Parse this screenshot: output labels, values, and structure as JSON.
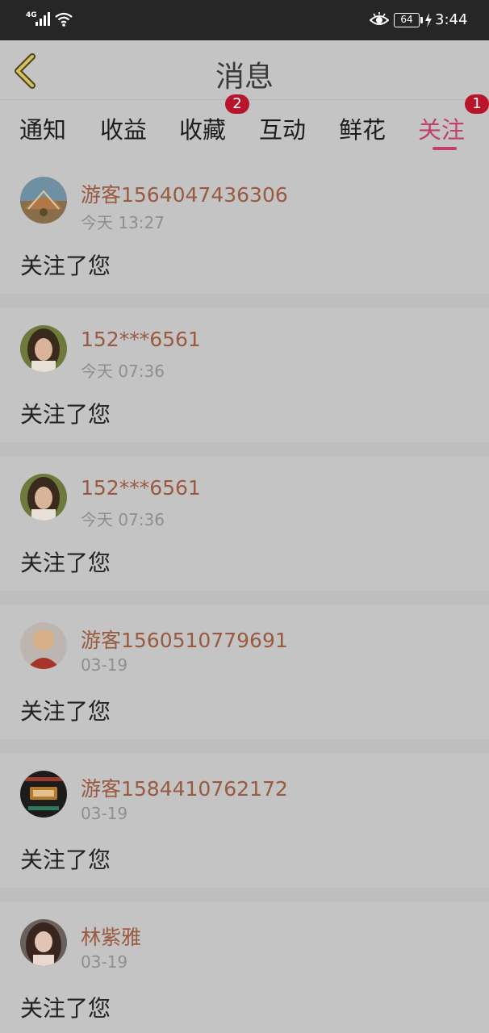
{
  "status_bar": {
    "network": "4G",
    "battery": "64",
    "time": "3:44"
  },
  "header": {
    "title": "消息"
  },
  "tabs": [
    {
      "label": "通知",
      "badge": null
    },
    {
      "label": "收益",
      "badge": null
    },
    {
      "label": "收藏",
      "badge": "2"
    },
    {
      "label": "互动",
      "badge": null
    },
    {
      "label": "鲜花",
      "badge": null
    },
    {
      "label": "关注",
      "badge": "1",
      "active": true
    }
  ],
  "colors": {
    "accent": "#c0406e",
    "username": "#9a5a3f",
    "badge": "#b8142c"
  },
  "feed": [
    {
      "username": "游客1564047436306",
      "time": "今天 13:27",
      "message": "关注了您",
      "avatar": "beach-sunset-avatar"
    },
    {
      "username": "152***6561",
      "time": "今天 07:36",
      "message": "关注了您",
      "avatar": "woman-portrait-avatar"
    },
    {
      "username": "152***6561",
      "time": "今天 07:36",
      "message": "关注了您",
      "avatar": "woman-portrait-avatar"
    },
    {
      "username": "游客1560510779691",
      "time": "03-19",
      "message": "关注了您",
      "avatar": "red-shirt-person-avatar"
    },
    {
      "username": "游客1584410762172",
      "time": "03-19",
      "message": "关注了您",
      "avatar": "dark-logo-avatar"
    },
    {
      "username": "林紫雅",
      "time": "03-19",
      "message": "关注了您",
      "avatar": "long-hair-girl-avatar"
    }
  ]
}
